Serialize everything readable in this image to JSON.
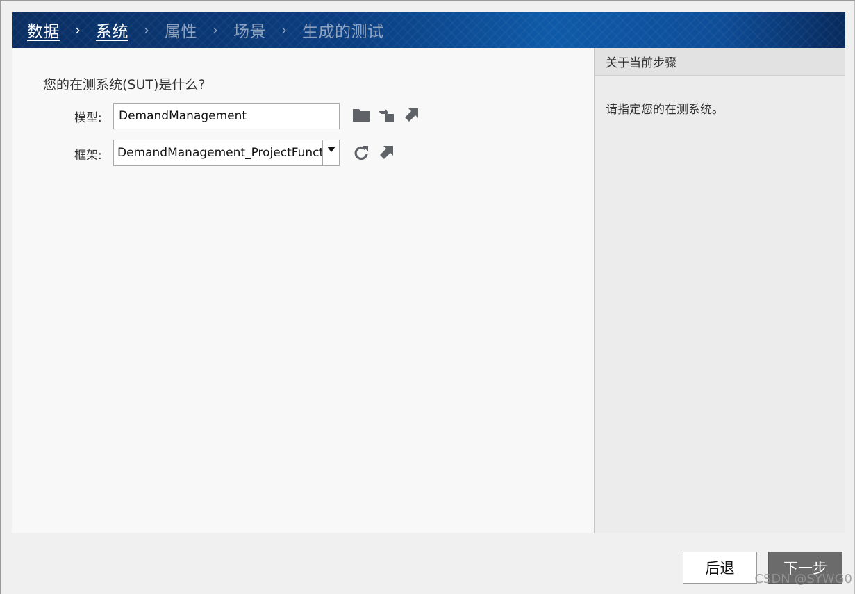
{
  "breadcrumb": {
    "items": [
      {
        "label": "数据",
        "state": "completed"
      },
      {
        "label": "系统",
        "state": "current"
      },
      {
        "label": "属性",
        "state": "pending"
      },
      {
        "label": "场景",
        "state": "pending"
      },
      {
        "label": "生成的测试",
        "state": "pending"
      }
    ],
    "separator": "›"
  },
  "main": {
    "question": "您的在测系统(SUT)是什么?",
    "model_label": "模型:",
    "model_value": "DemandManagement",
    "framework_label": "框架:",
    "framework_value": "DemandManagement_ProjectFunctio",
    "model_icons": [
      "folder-icon",
      "import-icon",
      "open-arrow-icon"
    ],
    "framework_icons": [
      "refresh-icon",
      "open-arrow-icon"
    ]
  },
  "side": {
    "title": "关于当前步骤",
    "text": "请指定您的在测系统。"
  },
  "footer": {
    "back_label": "后退",
    "next_label": "下一步"
  },
  "watermark": "CSDN @SYWG0",
  "colors": {
    "header_dark": "#0a2f63",
    "header_mid": "#0f5aa8",
    "next_button": "#6b6b6b",
    "panel_bg": "#f8f8f8",
    "side_bg": "#ececec"
  }
}
